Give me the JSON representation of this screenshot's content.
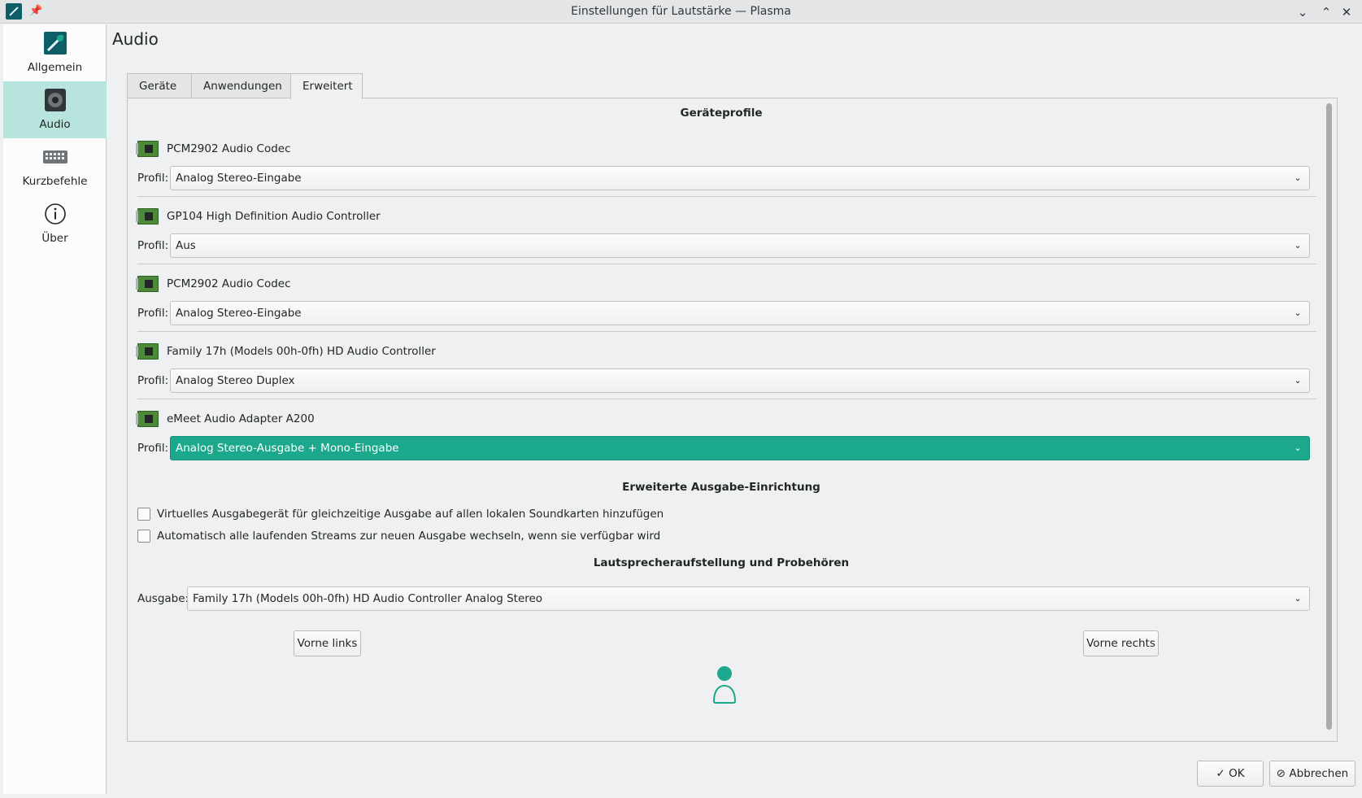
{
  "window": {
    "title": "Einstellungen für Lautstärke — Plasma",
    "buttons": [
      "minimize",
      "maximize",
      "close"
    ]
  },
  "sidebar": {
    "items": [
      {
        "label": "Allgemein",
        "icon": "settings-app-icon",
        "active": false
      },
      {
        "label": "Audio",
        "icon": "speaker-icon",
        "active": true
      },
      {
        "label": "Kurzbefehle",
        "icon": "keyboard-icon",
        "active": false
      },
      {
        "label": "Über",
        "icon": "info-icon",
        "active": false
      }
    ]
  },
  "page": {
    "title": "Audio"
  },
  "tabs": [
    {
      "label": "Geräte",
      "active": false
    },
    {
      "label": "Anwendungen",
      "active": false
    },
    {
      "label": "Erweitert",
      "active": true
    }
  ],
  "device_profiles": {
    "title": "Geräteprofile",
    "profile_label": "Profil:",
    "devices": [
      {
        "name": "PCM2902 Audio Codec",
        "profile": "Analog Stereo-Eingabe"
      },
      {
        "name": "GP104 High Definition Audio Controller",
        "profile": "Aus"
      },
      {
        "name": "PCM2902 Audio Codec",
        "profile": "Analog Stereo-Eingabe"
      },
      {
        "name": "Family 17h (Models 00h-0fh) HD Audio Controller",
        "profile": "Analog Stereo Duplex"
      },
      {
        "name": "eMeet Audio Adapter A200",
        "profile": "Analog Stereo-Ausgabe + Mono-Eingabe"
      }
    ]
  },
  "advanced_output": {
    "title": "Erweiterte Ausgabe-Einrichtung",
    "options": [
      {
        "label": "Virtuelles Ausgabegerät für gleichzeitige Ausgabe auf allen lokalen Soundkarten hinzufügen",
        "checked": false
      },
      {
        "label": "Automatisch alle laufenden Streams zur neuen Ausgabe wechseln, wenn sie verfügbar wird",
        "checked": false
      }
    ]
  },
  "speaker_setup": {
    "title": "Lautsprecheraufstellung und Probehören",
    "output_label": "Ausgabe:",
    "output_value": "Family 17h (Models 00h-0fh) HD Audio Controller Analog Stereo",
    "front_left": "Vorne links",
    "front_right": "Vorne rechts"
  },
  "footer": {
    "ok": "OK",
    "cancel": "Abbrechen"
  },
  "colors": {
    "accent": "#1ba88c",
    "sidebar_active": "#b8e4de",
    "background": "#eff0f1"
  }
}
